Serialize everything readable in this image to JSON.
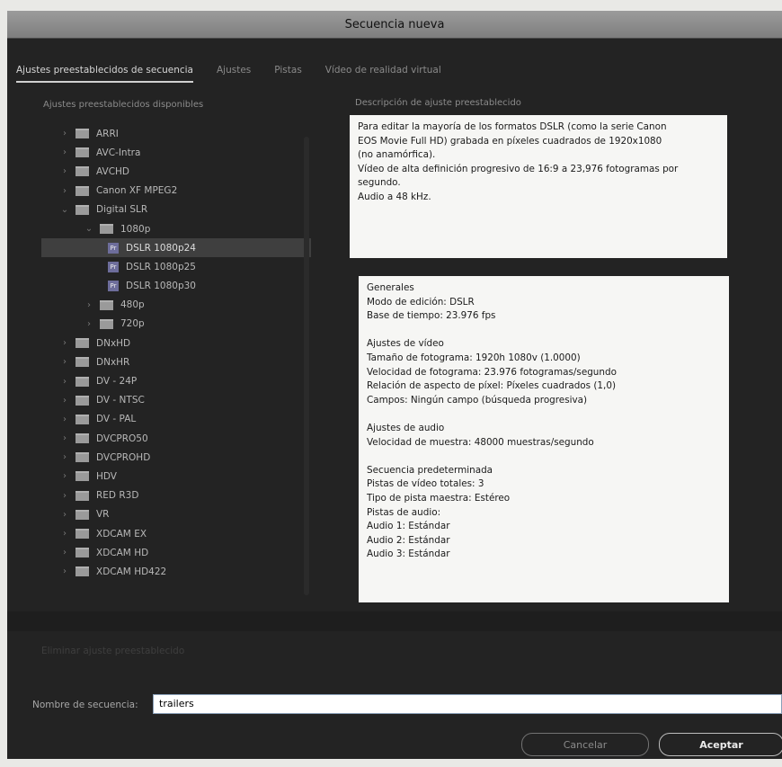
{
  "dialog": {
    "title": "Secuencia nueva"
  },
  "tabs": [
    {
      "label": "Ajustes preestablecidos de secuencia",
      "active": true
    },
    {
      "label": "Ajustes"
    },
    {
      "label": "Pistas"
    },
    {
      "label": "Vídeo de realidad virtual"
    }
  ],
  "presets": {
    "label": "Ajustes preestablecidos disponibles",
    "items": [
      {
        "label": "ARRI",
        "type": "folder",
        "level": 0,
        "expanded": false
      },
      {
        "label": "AVC-Intra",
        "type": "folder",
        "level": 0,
        "expanded": false
      },
      {
        "label": "AVCHD",
        "type": "folder",
        "level": 0,
        "expanded": false
      },
      {
        "label": "Canon XF MPEG2",
        "type": "folder",
        "level": 0,
        "expanded": false
      },
      {
        "label": "Digital SLR",
        "type": "folder",
        "level": 0,
        "expanded": true
      },
      {
        "label": "1080p",
        "type": "folder",
        "level": 1,
        "expanded": true
      },
      {
        "label": "DSLR 1080p24",
        "type": "preset",
        "level": 2,
        "selected": true
      },
      {
        "label": "DSLR 1080p25",
        "type": "preset",
        "level": 2
      },
      {
        "label": "DSLR 1080p30",
        "type": "preset",
        "level": 2
      },
      {
        "label": "480p",
        "type": "folder",
        "level": 1,
        "expanded": false
      },
      {
        "label": "720p",
        "type": "folder",
        "level": 1,
        "expanded": false
      },
      {
        "label": "DNxHD",
        "type": "folder",
        "level": 0,
        "expanded": false
      },
      {
        "label": "DNxHR",
        "type": "folder",
        "level": 0,
        "expanded": false
      },
      {
        "label": "DV - 24P",
        "type": "folder",
        "level": 0,
        "expanded": false
      },
      {
        "label": "DV - NTSC",
        "type": "folder",
        "level": 0,
        "expanded": false
      },
      {
        "label": "DV - PAL",
        "type": "folder",
        "level": 0,
        "expanded": false
      },
      {
        "label": "DVCPRO50",
        "type": "folder",
        "level": 0,
        "expanded": false
      },
      {
        "label": "DVCPROHD",
        "type": "folder",
        "level": 0,
        "expanded": false
      },
      {
        "label": "HDV",
        "type": "folder",
        "level": 0,
        "expanded": false
      },
      {
        "label": "RED R3D",
        "type": "folder",
        "level": 0,
        "expanded": false
      },
      {
        "label": "VR",
        "type": "folder",
        "level": 0,
        "expanded": false
      },
      {
        "label": "XDCAM EX",
        "type": "folder",
        "level": 0,
        "expanded": false
      },
      {
        "label": "XDCAM HD",
        "type": "folder",
        "level": 0,
        "expanded": false
      },
      {
        "label": "XDCAM HD422",
        "type": "folder",
        "level": 0,
        "expanded": false
      }
    ],
    "preset_icon_text": "Pr"
  },
  "description": {
    "label": "Descripción de ajuste preestablecido",
    "lines": [
      "Para editar la mayoría de los formatos DSLR (como la serie Canon",
      "EOS Movie Full HD) grabada en píxeles cuadrados de 1920x1080",
      "(no anamórfica).",
      "Vídeo de alta definición progresivo de 16:9 a 23,976 fotogramas por",
      "segundo.",
      "Audio a 48 kHz."
    ]
  },
  "details": {
    "lines": [
      "Generales",
      "Modo de edición: DSLR",
      "Base de tiempo: 23.976  fps",
      "",
      "Ajustes de vídeo",
      "Tamaño de fotograma: 1920h 1080v (1.0000)",
      "Velocidad de fotograma: 23.976  fotogramas/segundo",
      "Relación de aspecto de píxel: Píxeles cuadrados (1,0)",
      "Campos: Ningún campo (búsqueda progresiva)",
      "",
      "Ajustes de audio",
      "Velocidad de muestra: 48000 muestras/segundo",
      "",
      "Secuencia predeterminada",
      "Pistas de vídeo totales: 3",
      "Tipo de pista maestra: Estéreo",
      "Pistas de audio:",
      "Audio 1: Estándar",
      "Audio 2: Estándar",
      "Audio 3: Estándar"
    ]
  },
  "delete_preset_label": "Eliminar ajuste preestablecido",
  "sequence_name": {
    "label": "Nombre de secuencia:",
    "value": "trailers"
  },
  "buttons": {
    "cancel": "Cancelar",
    "accept": "Aceptar"
  },
  "icons": {
    "collapsed": "chevron-right-icon",
    "expanded": "chevron-down-icon",
    "folder": "folder-icon",
    "preset": "premiere-preset-icon"
  }
}
